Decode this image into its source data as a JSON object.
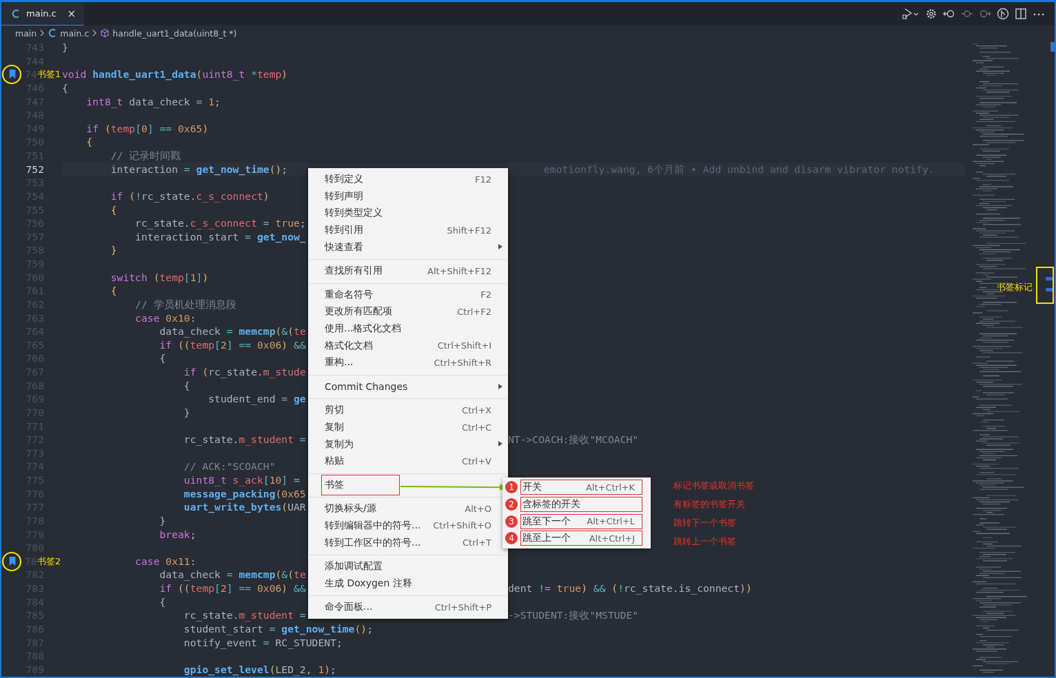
{
  "tabs": [
    {
      "label": "main.c",
      "selected": true,
      "close": "×"
    }
  ],
  "breadcrumb": [
    {
      "label": "main"
    },
    {
      "label": "main.c"
    },
    {
      "label": "handle_uart1_data(uint8_t *)"
    }
  ],
  "lines": [
    {
      "number": "743",
      "current": false,
      "bookmark": false,
      "tokens": [
        {
          "text": "}",
          "kind": "plain"
        }
      ]
    },
    {
      "number": "744",
      "current": false,
      "bookmark": false
    },
    {
      "number": "74",
      "current": false,
      "bookmark": true,
      "annotation": "书签1",
      "tokens": [
        {
          "text": "void ",
          "kind": "keyword"
        },
        {
          "text": "handle_uart1_data",
          "kind": "func"
        },
        {
          "text": "(",
          "kind": "paren"
        },
        {
          "text": "uint8_t ",
          "kind": "keyword"
        },
        {
          "text": "*",
          "kind": "op"
        },
        {
          "text": "temp",
          "kind": "var"
        },
        {
          "text": ")",
          "kind": "paren"
        }
      ]
    },
    {
      "number": "746",
      "current": false,
      "bookmark": false,
      "tokens": [
        {
          "text": "{",
          "kind": "plain"
        }
      ]
    },
    {
      "number": "747",
      "current": false,
      "bookmark": false,
      "tokens": [
        {
          "text": "    int8_t",
          "kind": "keyword"
        },
        {
          "text": " data_check ",
          "kind": "plain"
        },
        {
          "text": "= ",
          "kind": "op"
        },
        {
          "text": "1",
          "kind": "number"
        },
        {
          "text": ";",
          "kind": "plain"
        }
      ]
    },
    {
      "number": "748",
      "current": false,
      "bookmark": false
    },
    {
      "number": "749",
      "current": false,
      "bookmark": false,
      "tokens": [
        {
          "text": "    if ",
          "kind": "keyword"
        },
        {
          "text": "(",
          "kind": "paren"
        },
        {
          "text": "temp",
          "kind": "var"
        },
        {
          "text": "[",
          "kind": "op"
        },
        {
          "text": "0",
          "kind": "number"
        },
        {
          "text": "] == ",
          "kind": "op"
        },
        {
          "text": "0x65",
          "kind": "number"
        },
        {
          "text": ")",
          "kind": "paren"
        }
      ]
    },
    {
      "number": "750",
      "current": false,
      "bookmark": false,
      "tokens": [
        {
          "text": "    {",
          "kind": "paren"
        }
      ]
    },
    {
      "number": "751",
      "current": false,
      "bookmark": false,
      "tokens": [
        {
          "text": "        // 记录时间戳",
          "kind": "comment"
        }
      ]
    },
    {
      "number": "752",
      "current": true,
      "bookmark": false,
      "tokens": [
        {
          "text": "        interaction ",
          "kind": "plain"
        },
        {
          "text": "= ",
          "kind": "op"
        },
        {
          "text": "get_now_time",
          "kind": "func"
        },
        {
          "text": "()",
          "kind": "paren"
        },
        {
          "text": ";",
          "kind": "plain"
        }
      ],
      "blame": "emotionfly.wang, 6个月前 • Add unbind and disarm vibrator notify."
    },
    {
      "number": "753",
      "current": false,
      "bookmark": false
    },
    {
      "number": "754",
      "current": false,
      "bookmark": false,
      "tokens": [
        {
          "text": "        if ",
          "kind": "keyword"
        },
        {
          "text": "(",
          "kind": "paren"
        },
        {
          "text": "!",
          "kind": "op"
        },
        {
          "text": "rc_state.",
          "kind": "plain"
        },
        {
          "text": "c_s_connect",
          "kind": "var"
        },
        {
          "text": ")",
          "kind": "paren"
        }
      ]
    },
    {
      "number": "755",
      "current": false,
      "bookmark": false,
      "tokens": [
        {
          "text": "        {",
          "kind": "paren"
        }
      ]
    },
    {
      "number": "756",
      "current": false,
      "bookmark": false,
      "tokens": [
        {
          "text": "            rc_state.",
          "kind": "plain"
        },
        {
          "text": "c_s_connect",
          "kind": "var"
        },
        {
          "text": " = ",
          "kind": "op"
        },
        {
          "text": "true",
          "kind": "number"
        },
        {
          "text": ";",
          "kind": "plain"
        }
      ]
    },
    {
      "number": "757",
      "current": false,
      "bookmark": false,
      "tokens": [
        {
          "text": "            interaction_start ",
          "kind": "plain"
        },
        {
          "text": "= ",
          "kind": "op"
        },
        {
          "text": "get_now_",
          "kind": "func"
        }
      ]
    },
    {
      "number": "758",
      "current": false,
      "bookmark": false,
      "tokens": [
        {
          "text": "        }",
          "kind": "paren"
        }
      ]
    },
    {
      "number": "759",
      "current": false,
      "bookmark": false
    },
    {
      "number": "760",
      "current": false,
      "bookmark": false,
      "tokens": [
        {
          "text": "        switch ",
          "kind": "keyword"
        },
        {
          "text": "(",
          "kind": "paren"
        },
        {
          "text": "temp",
          "kind": "var"
        },
        {
          "text": "[",
          "kind": "op"
        },
        {
          "text": "1",
          "kind": "number"
        },
        {
          "text": "]",
          "kind": "op"
        },
        {
          "text": ")",
          "kind": "paren"
        }
      ]
    },
    {
      "number": "761",
      "current": false,
      "bookmark": false,
      "tokens": [
        {
          "text": "        {",
          "kind": "paren"
        }
      ]
    },
    {
      "number": "762",
      "current": false,
      "bookmark": false,
      "tokens": [
        {
          "text": "            // 学员机处理消息段",
          "kind": "comment"
        }
      ]
    },
    {
      "number": "763",
      "current": false,
      "bookmark": false,
      "tokens": [
        {
          "text": "            case ",
          "kind": "keyword"
        },
        {
          "text": "0x10",
          "kind": "number"
        },
        {
          "text": ":",
          "kind": "plain"
        }
      ]
    },
    {
      "number": "764",
      "current": false,
      "bookmark": false,
      "tokens": [
        {
          "text": "                data_check ",
          "kind": "plain"
        },
        {
          "text": "= ",
          "kind": "op"
        },
        {
          "text": "memcmp",
          "kind": "func"
        },
        {
          "text": "(",
          "kind": "paren"
        },
        {
          "text": "&",
          "kind": "op"
        },
        {
          "text": "(",
          "kind": "paren"
        },
        {
          "text": "te",
          "kind": "var"
        }
      ]
    },
    {
      "number": "765",
      "current": false,
      "bookmark": false,
      "tokens": [
        {
          "text": "                if ",
          "kind": "keyword"
        },
        {
          "text": "((",
          "kind": "paren"
        },
        {
          "text": "temp",
          "kind": "var"
        },
        {
          "text": "[",
          "kind": "op"
        },
        {
          "text": "2",
          "kind": "number"
        },
        {
          "text": "] == ",
          "kind": "op"
        },
        {
          "text": "0x06",
          "kind": "number"
        },
        {
          "text": ")",
          "kind": "paren"
        },
        {
          "text": " &&",
          "kind": "op"
        }
      ]
    },
    {
      "number": "766",
      "current": false,
      "bookmark": false,
      "tokens": [
        {
          "text": "                {",
          "kind": "plain"
        }
      ]
    },
    {
      "number": "767",
      "current": false,
      "bookmark": false,
      "tokens": [
        {
          "text": "                    if ",
          "kind": "keyword"
        },
        {
          "text": "(",
          "kind": "paren"
        },
        {
          "text": "rc_state.",
          "kind": "plain"
        },
        {
          "text": "m_stude",
          "kind": "var"
        }
      ]
    },
    {
      "number": "768",
      "current": false,
      "bookmark": false,
      "tokens": [
        {
          "text": "                    {",
          "kind": "plain"
        }
      ]
    },
    {
      "number": "769",
      "current": false,
      "bookmark": false,
      "tokens": [
        {
          "text": "                        student_end ",
          "kind": "plain"
        },
        {
          "text": "= ",
          "kind": "op"
        },
        {
          "text": "ge",
          "kind": "func"
        }
      ]
    },
    {
      "number": "770",
      "current": false,
      "bookmark": false,
      "tokens": [
        {
          "text": "                    }",
          "kind": "plain"
        }
      ]
    },
    {
      "number": "771",
      "current": false,
      "bookmark": false
    },
    {
      "number": "772",
      "current": false,
      "bookmark": false,
      "tokens": [
        {
          "text": "                    rc_state.",
          "kind": "plain"
        },
        {
          "text": "m_student",
          "kind": "var"
        },
        {
          "text": " =",
          "kind": "op"
        }
      ],
      "tail": [
        {
          "text": "NT->COACH:接收\"MCOACH\"",
          "kind": "comment"
        }
      ]
    },
    {
      "number": "773",
      "current": false,
      "bookmark": false
    },
    {
      "number": "774",
      "current": false,
      "bookmark": false,
      "tokens": [
        {
          "text": "                    // ACK:\"SCOACH\"",
          "kind": "comment"
        }
      ]
    },
    {
      "number": "775",
      "current": false,
      "bookmark": false,
      "tokens": [
        {
          "text": "                    uint8_t ",
          "kind": "keyword"
        },
        {
          "text": "s_ack",
          "kind": "var"
        },
        {
          "text": "[",
          "kind": "op"
        },
        {
          "text": "10",
          "kind": "number"
        },
        {
          "text": "] =",
          "kind": "op"
        }
      ]
    },
    {
      "number": "776",
      "current": false,
      "bookmark": false,
      "tokens": [
        {
          "text": "                    message_packing",
          "kind": "func"
        },
        {
          "text": "(",
          "kind": "paren"
        },
        {
          "text": "0x65",
          "kind": "number"
        }
      ]
    },
    {
      "number": "777",
      "current": false,
      "bookmark": false,
      "tokens": [
        {
          "text": "                    uart_write_bytes",
          "kind": "func"
        },
        {
          "text": "(",
          "kind": "paren"
        },
        {
          "text": "UAR",
          "kind": "plain"
        }
      ]
    },
    {
      "number": "778",
      "current": false,
      "bookmark": false,
      "tokens": [
        {
          "text": "                }",
          "kind": "plain"
        }
      ]
    },
    {
      "number": "779",
      "current": false,
      "bookmark": false,
      "tokens": [
        {
          "text": "                break",
          "kind": "keyword"
        },
        {
          "text": ";",
          "kind": "plain"
        }
      ]
    },
    {
      "number": "780",
      "current": false,
      "bookmark": false
    },
    {
      "number": "78",
      "current": false,
      "bookmark": true,
      "annotation": "书签2",
      "tokens": [
        {
          "text": "            case ",
          "kind": "keyword"
        },
        {
          "text": "0x11",
          "kind": "number"
        },
        {
          "text": ":",
          "kind": "plain"
        }
      ]
    },
    {
      "number": "782",
      "current": false,
      "bookmark": false,
      "tokens": [
        {
          "text": "                data_check ",
          "kind": "plain"
        },
        {
          "text": "= ",
          "kind": "op"
        },
        {
          "text": "memcmp",
          "kind": "func"
        },
        {
          "text": "(",
          "kind": "paren"
        },
        {
          "text": "&",
          "kind": "op"
        },
        {
          "text": "(",
          "kind": "paren"
        },
        {
          "text": "te",
          "kind": "var"
        }
      ]
    },
    {
      "number": "783",
      "current": false,
      "bookmark": false,
      "tokens": [
        {
          "text": "                if ",
          "kind": "keyword"
        },
        {
          "text": "((",
          "kind": "paren"
        },
        {
          "text": "temp",
          "kind": "var"
        },
        {
          "text": "[",
          "kind": "op"
        },
        {
          "text": "2",
          "kind": "number"
        },
        {
          "text": "] == ",
          "kind": "op"
        },
        {
          "text": "0x06",
          "kind": "number"
        },
        {
          "text": ")",
          "kind": "paren"
        },
        {
          "text": " &&",
          "kind": "op"
        }
      ],
      "tail": [
        {
          "text": "dent ",
          "kind": "plain"
        },
        {
          "text": "!= ",
          "kind": "op"
        },
        {
          "text": "true",
          "kind": "number"
        },
        {
          "text": ")",
          "kind": "paren"
        },
        {
          "text": " && ",
          "kind": "op"
        },
        {
          "text": "(",
          "kind": "paren"
        },
        {
          "text": "!",
          "kind": "op"
        },
        {
          "text": "rc_state.is_connect",
          "kind": "plain"
        },
        {
          "text": "))",
          "kind": "paren"
        }
      ]
    },
    {
      "number": "784",
      "current": false,
      "bookmark": false,
      "tokens": [
        {
          "text": "                {",
          "kind": "plain"
        }
      ]
    },
    {
      "number": "785",
      "current": false,
      "bookmark": false,
      "tokens": [
        {
          "text": "                    rc_state.",
          "kind": "plain"
        },
        {
          "text": "m_student",
          "kind": "var"
        },
        {
          "text": " =",
          "kind": "op"
        }
      ],
      "tail": [
        {
          "text": "->STUDENT:接收\"MSTUDE\"",
          "kind": "comment"
        }
      ]
    },
    {
      "number": "786",
      "current": false,
      "bookmark": false,
      "tokens": [
        {
          "text": "                    student_start ",
          "kind": "plain"
        },
        {
          "text": "= ",
          "kind": "op"
        },
        {
          "text": "get_now_time",
          "kind": "func"
        },
        {
          "text": "()",
          "kind": "paren"
        },
        {
          "text": ";",
          "kind": "plain"
        }
      ]
    },
    {
      "number": "787",
      "current": false,
      "bookmark": false,
      "tokens": [
        {
          "text": "                    notify_event ",
          "kind": "plain"
        },
        {
          "text": "=",
          "kind": "op"
        },
        {
          "text": " RC_STUDENT;",
          "kind": "plain"
        }
      ]
    },
    {
      "number": "788",
      "current": false,
      "bookmark": false
    },
    {
      "number": "789",
      "current": false,
      "bookmark": false,
      "tokens": [
        {
          "text": "                    gpio_set_level",
          "kind": "func"
        },
        {
          "text": "(",
          "kind": "paren"
        },
        {
          "text": "LED_2, ",
          "kind": "plain"
        },
        {
          "text": "1",
          "kind": "number"
        },
        {
          "text": ")",
          "kind": "paren"
        },
        {
          "text": ";",
          "kind": "plain"
        }
      ]
    }
  ],
  "context_menu": {
    "groups": [
      [
        {
          "label": "转到定义",
          "shortcut": "F12",
          "submenu": false,
          "boxed": false
        },
        {
          "label": "转到声明",
          "submenu": false,
          "boxed": false
        },
        {
          "label": "转到类型定义",
          "submenu": false,
          "boxed": false
        },
        {
          "label": "转到引用",
          "shortcut": "Shift+F12",
          "submenu": false,
          "boxed": false
        },
        {
          "label": "快速查看",
          "submenu": true,
          "boxed": false
        }
      ],
      [
        {
          "label": "查找所有引用",
          "shortcut": "Alt+Shift+F12",
          "submenu": false,
          "boxed": false
        }
      ],
      [
        {
          "label": "重命名符号",
          "shortcut": "F2",
          "submenu": false,
          "boxed": false
        },
        {
          "label": "更改所有匹配项",
          "shortcut": "Ctrl+F2",
          "submenu": false,
          "boxed": false
        },
        {
          "label": "使用...格式化文档",
          "submenu": false,
          "boxed": false
        },
        {
          "label": "格式化文档",
          "shortcut": "Ctrl+Shift+I",
          "submenu": false,
          "boxed": false
        },
        {
          "label": "重构...",
          "shortcut": "Ctrl+Shift+R",
          "submenu": false,
          "boxed": false
        }
      ],
      [
        {
          "label": "Commit Changes",
          "submenu": true,
          "boxed": false
        }
      ],
      [
        {
          "label": "剪切",
          "shortcut": "Ctrl+X",
          "submenu": false,
          "boxed": false
        },
        {
          "label": "复制",
          "shortcut": "Ctrl+C",
          "submenu": false,
          "boxed": false
        },
        {
          "label": "复制为",
          "submenu": true,
          "boxed": false
        },
        {
          "label": "粘贴",
          "shortcut": "Ctrl+V",
          "submenu": false,
          "boxed": false
        }
      ],
      [
        {
          "label": "书签",
          "submenu": false,
          "boxed": true
        }
      ],
      [
        {
          "label": "切换标头/源",
          "shortcut": "Alt+O",
          "submenu": false,
          "boxed": false
        },
        {
          "label": "转到编辑器中的符号...",
          "shortcut": "Ctrl+Shift+O",
          "submenu": false,
          "boxed": false
        },
        {
          "label": "转到工作区中的符号...",
          "shortcut": "Ctrl+T",
          "submenu": false,
          "boxed": false
        }
      ],
      [
        {
          "label": "添加调试配置",
          "submenu": false,
          "boxed": false
        },
        {
          "label": "生成 Doxygen 注释",
          "submenu": false,
          "boxed": false
        }
      ],
      [
        {
          "label": "命令面板...",
          "shortcut": "Ctrl+Shift+P",
          "submenu": false,
          "boxed": false
        }
      ]
    ]
  },
  "bookmark_submenu": {
    "items": [
      {
        "badge": "1",
        "label": "开关",
        "shortcut": "Alt+Ctrl+K",
        "note": "标记书签或取消书签"
      },
      {
        "badge": "2",
        "label": "含标签的开关",
        "note": "有标签的书签开关"
      },
      {
        "badge": "3",
        "label": "跳至下一个",
        "shortcut": "Alt+Ctrl+L",
        "note": "跳转下一个书签"
      },
      {
        "badge": "4",
        "label": "跳至上一个",
        "shortcut": "Alt+Ctrl+J",
        "note": "跳转上一个书签"
      }
    ]
  },
  "scrollbar_annotation": {
    "label": "书签标记"
  }
}
